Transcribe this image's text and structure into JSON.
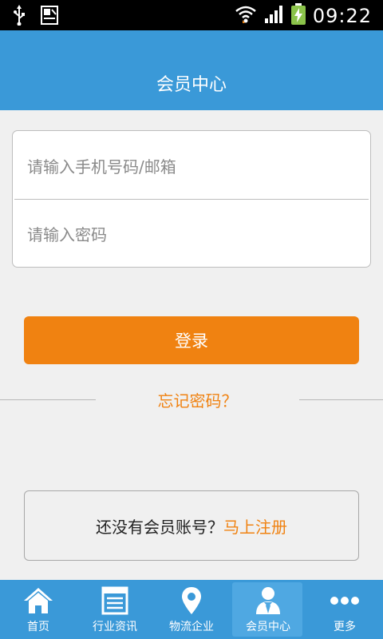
{
  "status_bar": {
    "time": "09:22",
    "icons": [
      "usb-icon",
      "keyboard-icon",
      "wifi-icon",
      "signal-icon",
      "battery-charging-icon"
    ]
  },
  "header": {
    "title": "会员中心"
  },
  "login_form": {
    "account_placeholder": "请输入手机号码/邮箱",
    "password_placeholder": "请输入密码",
    "account_value": "",
    "password_value": ""
  },
  "login_button": {
    "label": "登录"
  },
  "forgot_password": {
    "label": "忘记密码？"
  },
  "register": {
    "prompt": "还没有会员账号？",
    "link": "马上注册"
  },
  "bottom_nav": {
    "items": [
      {
        "label": "首页",
        "icon": "home-icon"
      },
      {
        "label": "行业资讯",
        "icon": "news-icon"
      },
      {
        "label": "物流企业",
        "icon": "location-pin-icon"
      },
      {
        "label": "会员中心",
        "icon": "member-icon",
        "active": true
      },
      {
        "label": "更多",
        "icon": "more-dots-icon"
      }
    ]
  },
  "colors": {
    "header": "#3a99d8",
    "accent": "#f08211",
    "background": "#f0f0f0",
    "status_bar": "#000000"
  }
}
